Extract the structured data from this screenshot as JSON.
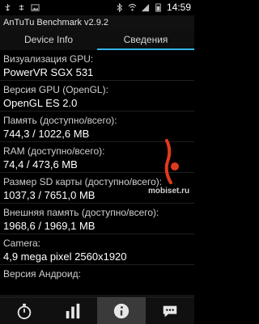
{
  "status": {
    "time": "14:59",
    "icons": [
      "usb-icon",
      "usb-debug-icon",
      "image-icon",
      "bluetooth-icon",
      "wifi-icon",
      "signal-icon",
      "battery-icon"
    ]
  },
  "app": {
    "title": "AnTuTu Benchmark v2.9.2"
  },
  "tabs": [
    {
      "label": "Device Info",
      "selected": false
    },
    {
      "label": "Сведения",
      "selected": true
    }
  ],
  "rows": [
    {
      "label": "Визуализация GPU:",
      "value": "PowerVR SGX 531"
    },
    {
      "label": "Версия GPU (OpenGL):",
      "value": "OpenGL ES 2.0"
    },
    {
      "label": "Память (доступно/всего):",
      "value": "744,3 / 1022,6 MB"
    },
    {
      "label": "RAM (доступно/всего):",
      "value": "74,4 / 473,6 MB"
    },
    {
      "label": "Размер SD карты (доступно/всего):",
      "value": "1037,3 / 7651,0 MB"
    },
    {
      "label": "Внешняя память (доступно/всего):",
      "value": "1968,6 / 1969,1 MB"
    },
    {
      "label": "Camera:",
      "value": "4,9 mega pixel    2560x1920"
    },
    {
      "label": "Версия Андроид:",
      "value": ""
    }
  ],
  "watermark": {
    "text": "mobiset.ru"
  },
  "bottom_tabs": [
    {
      "icon": "stopwatch-icon",
      "active": false
    },
    {
      "icon": "bar-chart-icon",
      "active": false
    },
    {
      "icon": "info-icon",
      "active": true
    },
    {
      "icon": "chat-icon",
      "active": false
    }
  ],
  "colors": {
    "accent": "#33b5e5",
    "watermark_red": "#e03a1e"
  }
}
